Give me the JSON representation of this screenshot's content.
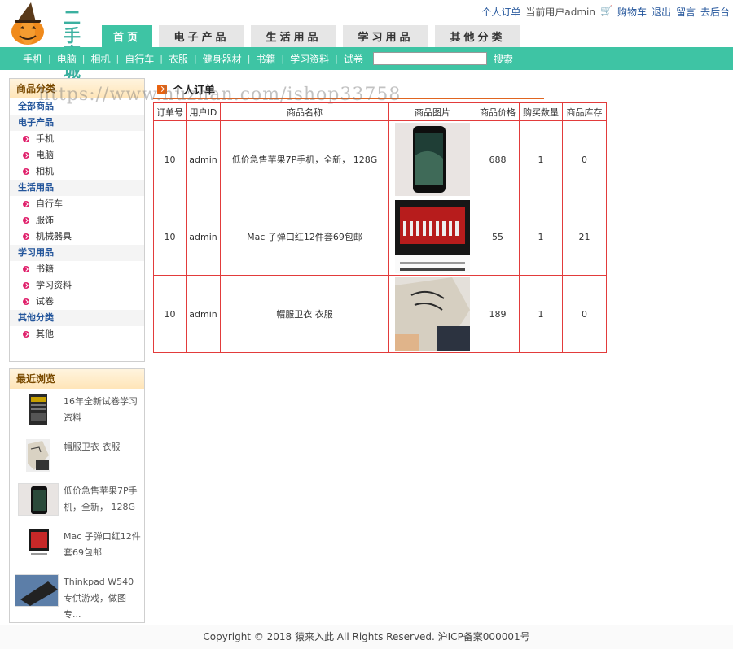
{
  "header": {
    "logo_text_line1": "二手",
    "logo_text_line2": "商城",
    "tabs": [
      {
        "label": "首页"
      },
      {
        "label": "电子产品"
      },
      {
        "label": "生活用品"
      },
      {
        "label": "学习用品"
      },
      {
        "label": "其他分类"
      }
    ],
    "top_links": {
      "my_orders": "个人订单",
      "current_user": "当前用户admin",
      "cart": "购物车",
      "logout": "退出",
      "message": "留言",
      "admin": "去后台"
    }
  },
  "subnav": {
    "items": [
      "手机",
      "电脑",
      "相机",
      "自行车",
      "衣服",
      "健身器材",
      "书籍",
      "学习资料",
      "试卷"
    ],
    "separator": "|",
    "search_value": "",
    "search_button": "搜索"
  },
  "sidebar": {
    "category_title": "商品分类",
    "all_label": "全部商品",
    "groups": [
      {
        "name": "电子产品",
        "items": [
          "手机",
          "电脑",
          "相机"
        ]
      },
      {
        "name": "生活用品",
        "items": [
          "自行车",
          "服饰",
          "机械器具"
        ]
      },
      {
        "name": "学习用品",
        "items": [
          "书籍",
          "学习资料",
          "试卷"
        ]
      },
      {
        "name": "其他分类",
        "items": [
          "其他"
        ]
      }
    ],
    "recent_title": "最近浏览",
    "recent": [
      {
        "title": "16年全新试卷学习资料"
      },
      {
        "title": "帽服卫衣 衣服"
      },
      {
        "title": "低价急售苹果7P手机，全新， 128G"
      },
      {
        "title": "Mac 子弹口红12件套69包邮"
      },
      {
        "title": "Thinkpad W540专供游戏，做图专..."
      }
    ]
  },
  "main": {
    "section_title": "个人订单",
    "watermark": "https://www.huzhan.com/ishop33758",
    "columns": [
      "订单号",
      "用户ID",
      "商品名称",
      "商品图片",
      "商品价格",
      "购买数量",
      "商品库存"
    ],
    "rows": [
      {
        "order_id": "10",
        "user_id": "admin",
        "name": "低价急售苹果7P手机，全新， 128G",
        "image": "iphone-photo",
        "price": "688",
        "qty": "1",
        "stock": "0"
      },
      {
        "order_id": "10",
        "user_id": "admin",
        "name": "Mac 子弹口红12件套69包邮",
        "image": "lipstick-set-photo",
        "price": "55",
        "qty": "1",
        "stock": "21"
      },
      {
        "order_id": "10",
        "user_id": "admin",
        "name": "帽服卫衣 衣服",
        "image": "hoodie-photo",
        "price": "189",
        "qty": "1",
        "stock": "0"
      }
    ]
  },
  "footer": {
    "copyright": "Copyright © 2018 猿来入此 All Rights Reserved. 沪ICP备案000001号"
  },
  "colors": {
    "accent": "#3ec4a4",
    "table_border": "#e23b3b",
    "title_underline": "#e06520",
    "link": "#23559b"
  }
}
